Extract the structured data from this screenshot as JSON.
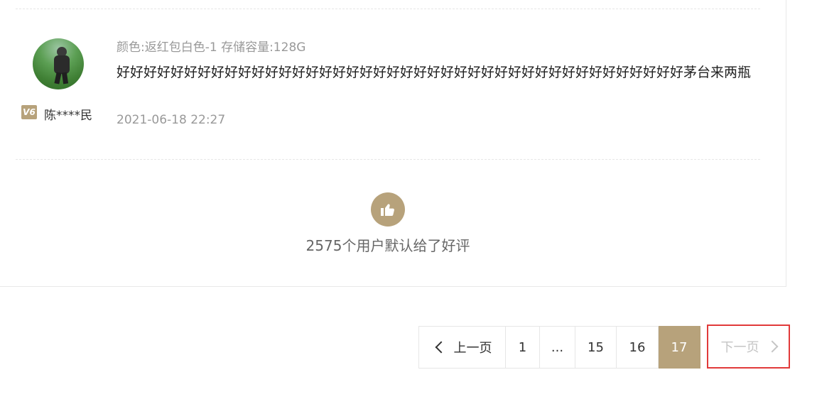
{
  "review": {
    "username": "陈****民",
    "vip_badge": "V6",
    "spec": "颜色:返红包白色-1 存储容量:128G",
    "content": "好好好好好好好好好好好好好好好好好好好好好好好好好好好好好好好好好好好好好好好好好好茅台来两瓶",
    "date": "2021-06-18 22:27"
  },
  "summary": {
    "default_good": "2575个用户默认给了好评",
    "icon": "thumbs-up-icon"
  },
  "pagination": {
    "prev_label": "上一页",
    "next_label": "下一页",
    "pages": [
      "1",
      "...",
      "15",
      "16",
      "17"
    ],
    "current": "17"
  },
  "colors": {
    "accent": "#b7a27b",
    "highlight_border": "#e13a3a"
  }
}
